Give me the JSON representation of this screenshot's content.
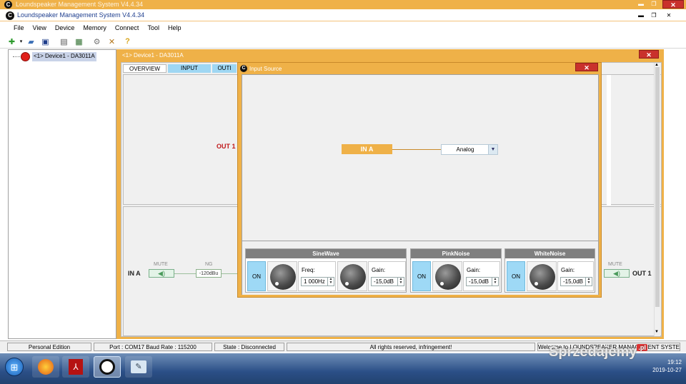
{
  "window": {
    "ghost_title": "Loundspeaker Management System V4.4.34",
    "title": "Loundspeaker Management System V4.4.34"
  },
  "menu": [
    "File",
    "View",
    "Device",
    "Memory",
    "Connect",
    "Tool",
    "Help"
  ],
  "tree": {
    "device_label": "<1> Device1 - DA3011A"
  },
  "device_window": {
    "title": "<1> Device1 - DA3011A",
    "tabs": [
      "OVERVIEW",
      "INPUT",
      "OUTI"
    ],
    "out1_label": "OUT 1",
    "in_a_label": "IN A",
    "mute_label": "MUTE",
    "ng_label": "NG",
    "ng_value": "-120dBu",
    "mute_right_label": "MUTE",
    "out1_right_label": "OUT 1"
  },
  "dialog": {
    "title": "Input Source",
    "input_label": "IN A",
    "source_value": "Analog",
    "sinewave": {
      "title": "SineWave",
      "on_label": "ON",
      "freq_label": "Freq:",
      "freq_value": "1 000Hz",
      "gain_label": "Gain:",
      "gain_value": "-15,0dB"
    },
    "pinknoise": {
      "title": "PinkNoise",
      "on_label": "ON",
      "gain_label": "Gain:",
      "gain_value": "-15,0dB"
    },
    "whitenoise": {
      "title": "WhiteNoise",
      "on_label": "ON",
      "gain_label": "Gain:",
      "gain_value": "-15,0dB"
    }
  },
  "status": {
    "edition": "Personal Edition",
    "port": "Port : COM17  Baud Rate : 115200",
    "state": "State : Disconnected",
    "rights": "All rights reserved, infringement!",
    "welcome": "Welcome to LOUNDSPEAKER MANAGEMENT SYSTEM"
  },
  "taskbar": {
    "time": "19:12",
    "date": "2019-10-27"
  },
  "watermark": {
    "text": "Sprzedajemy",
    "tld": ".pl"
  },
  "colors": {
    "accent": "#efb148",
    "on_button": "#9ed9f6",
    "mute": "#4a9a5b",
    "out_red": "#c0181a"
  }
}
